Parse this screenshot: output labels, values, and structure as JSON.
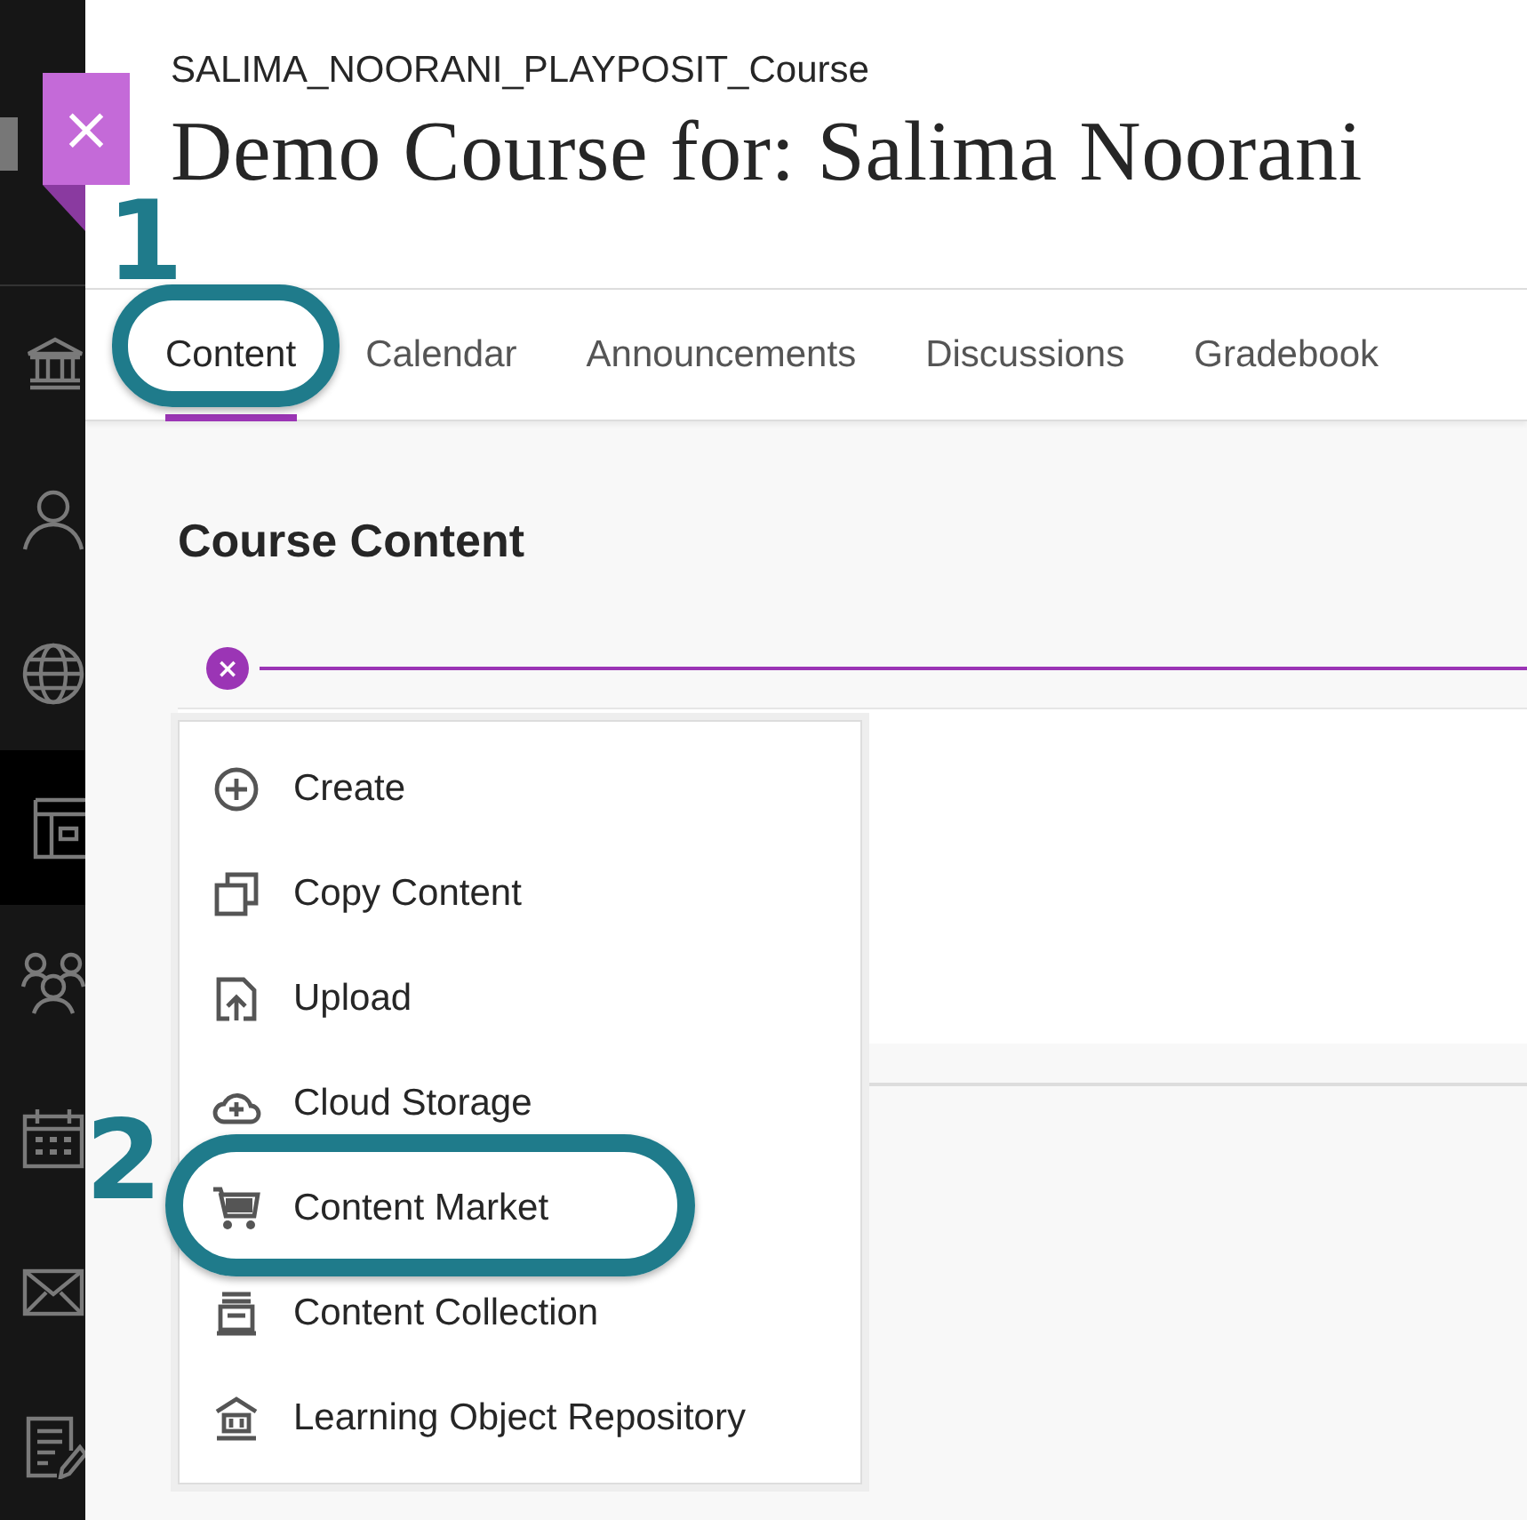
{
  "sidebar": {
    "items": [
      {
        "selected": false
      },
      {
        "selected": false
      },
      {
        "selected": false
      },
      {
        "selected": true
      },
      {
        "selected": false
      },
      {
        "selected": false
      },
      {
        "selected": false
      },
      {
        "selected": false
      }
    ]
  },
  "close_button": {
    "label": "×"
  },
  "course": {
    "id": "SALIMA_NOORANI_PLAYPOSIT_Course",
    "title": "Demo Course for: Salima Noorani"
  },
  "tabs": [
    {
      "label": "Content",
      "selected": true,
      "circled": true,
      "step": "1"
    },
    {
      "label": "Calendar",
      "selected": false,
      "circled": false
    },
    {
      "label": "Announcements",
      "selected": false,
      "circled": false
    },
    {
      "label": "Discussions",
      "selected": false,
      "circled": false
    },
    {
      "label": "Gradebook",
      "selected": false,
      "circled": false
    }
  ],
  "section_title": "Course Content",
  "add_menu": {
    "expanded": true,
    "toggle_label": "×",
    "items": [
      {
        "label": "Create",
        "circled": false
      },
      {
        "label": "Copy Content",
        "circled": false
      },
      {
        "label": "Upload",
        "circled": false
      },
      {
        "label": "Cloud Storage",
        "circled": false
      },
      {
        "label": "Content Market",
        "circled": true,
        "step": "2"
      },
      {
        "label": "Content Collection",
        "circled": false
      },
      {
        "label": "Learning Object Repository",
        "circled": false
      }
    ]
  }
}
